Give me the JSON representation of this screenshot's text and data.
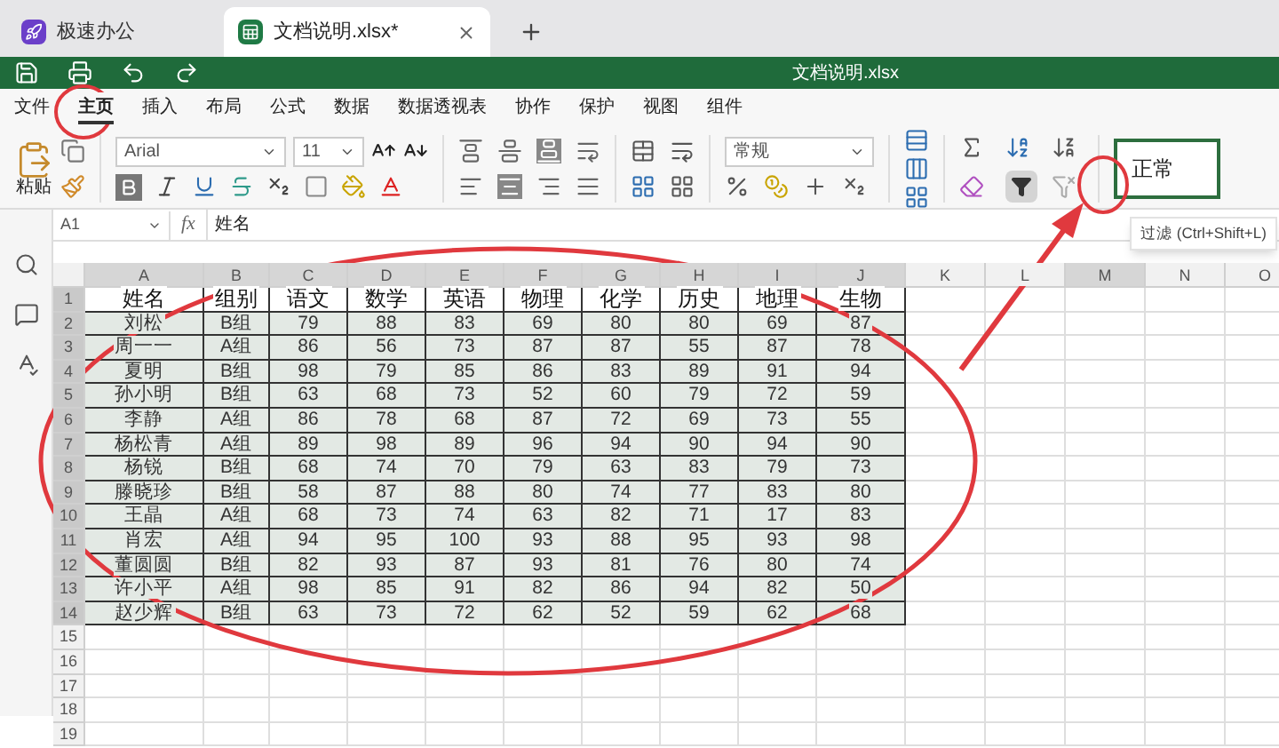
{
  "app_tab": {
    "title": "极速办公"
  },
  "doc_tabs": [
    {
      "title": "文档说明.xlsx*",
      "selected": true
    }
  ],
  "quick_bar": {
    "title": "文档说明.xlsx"
  },
  "menu": [
    {
      "label": "文件",
      "selected": false
    },
    {
      "label": "主页",
      "selected": true
    },
    {
      "label": "插入",
      "selected": false
    },
    {
      "label": "布局",
      "selected": false
    },
    {
      "label": "公式",
      "selected": false
    },
    {
      "label": "数据",
      "selected": false
    },
    {
      "label": "数据透视表",
      "selected": false
    },
    {
      "label": "协作",
      "selected": false
    },
    {
      "label": "保护",
      "selected": false
    },
    {
      "label": "视图",
      "selected": false
    },
    {
      "label": "组件",
      "selected": false
    }
  ],
  "ribbon": {
    "paste_label": "粘贴",
    "font": "Arial",
    "size": "11",
    "number_format": "常规",
    "style": "正常",
    "filter_active": true
  },
  "formula_bar": {
    "cell": "A1",
    "fx": "fx",
    "value": "姓名"
  },
  "sheet": {
    "columns": [
      {
        "label": "A",
        "selected": true
      },
      {
        "label": "B",
        "selected": true
      },
      {
        "label": "C",
        "selected": true
      },
      {
        "label": "D",
        "selected": true
      },
      {
        "label": "E",
        "selected": true
      },
      {
        "label": "F",
        "selected": true
      },
      {
        "label": "G",
        "selected": true
      },
      {
        "label": "H",
        "selected": true
      },
      {
        "label": "I",
        "selected": true
      },
      {
        "label": "J",
        "selected": true
      },
      {
        "label": "K",
        "selected": false
      },
      {
        "label": "L",
        "selected": false
      },
      {
        "label": "M",
        "selected": true
      },
      {
        "label": "N",
        "selected": false
      },
      {
        "label": "O",
        "selected": false
      }
    ],
    "row_headers": [
      {
        "label": "1",
        "selected": true
      },
      {
        "label": "2",
        "selected": true
      },
      {
        "label": "3",
        "selected": true
      },
      {
        "label": "4",
        "selected": true
      },
      {
        "label": "5",
        "selected": true
      },
      {
        "label": "6",
        "selected": true
      },
      {
        "label": "7",
        "selected": true
      },
      {
        "label": "8",
        "selected": true
      },
      {
        "label": "9",
        "selected": true
      },
      {
        "label": "10",
        "selected": true
      },
      {
        "label": "11",
        "selected": true
      },
      {
        "label": "12",
        "selected": true
      },
      {
        "label": "13",
        "selected": true
      },
      {
        "label": "14",
        "selected": true
      },
      {
        "label": "15",
        "selected": false
      },
      {
        "label": "16",
        "selected": false
      },
      {
        "label": "17",
        "selected": false
      },
      {
        "label": "18",
        "selected": false
      },
      {
        "label": "19",
        "selected": false
      }
    ],
    "rows": [
      [
        "姓名",
        "组别",
        "语文",
        "数学",
        "英语",
        "物理",
        "化学",
        "历史",
        "地理",
        "生物"
      ],
      [
        "刘松",
        "B组",
        "79",
        "88",
        "83",
        "69",
        "80",
        "80",
        "69",
        "87"
      ],
      [
        "周一一",
        "A组",
        "86",
        "56",
        "73",
        "87",
        "87",
        "55",
        "87",
        "78"
      ],
      [
        "夏明",
        "B组",
        "98",
        "79",
        "85",
        "86",
        "83",
        "89",
        "91",
        "94"
      ],
      [
        "孙小明",
        "B组",
        "63",
        "68",
        "73",
        "52",
        "60",
        "79",
        "72",
        "59"
      ],
      [
        "李静",
        "A组",
        "86",
        "78",
        "68",
        "87",
        "72",
        "69",
        "73",
        "55"
      ],
      [
        "杨松青",
        "A组",
        "89",
        "98",
        "89",
        "96",
        "94",
        "90",
        "94",
        "90"
      ],
      [
        "杨锐",
        "B组",
        "68",
        "74",
        "70",
        "79",
        "63",
        "83",
        "79",
        "73"
      ],
      [
        "滕晓珍",
        "B组",
        "58",
        "87",
        "88",
        "80",
        "74",
        "77",
        "83",
        "80"
      ],
      [
        "王晶",
        "A组",
        "68",
        "73",
        "74",
        "63",
        "82",
        "71",
        "17",
        "83"
      ],
      [
        "肖宏",
        "A组",
        "94",
        "95",
        "100",
        "93",
        "88",
        "95",
        "93",
        "98"
      ],
      [
        "董圆圆",
        "B组",
        "82",
        "93",
        "87",
        "93",
        "81",
        "76",
        "80",
        "74"
      ],
      [
        "许小平",
        "A组",
        "98",
        "85",
        "91",
        "82",
        "86",
        "94",
        "82",
        "50"
      ],
      [
        "赵少辉",
        "B组",
        "63",
        "73",
        "72",
        "62",
        "52",
        "59",
        "62",
        "68"
      ]
    ]
  },
  "tooltip": "过滤 (Ctrl+Shift+L)"
}
